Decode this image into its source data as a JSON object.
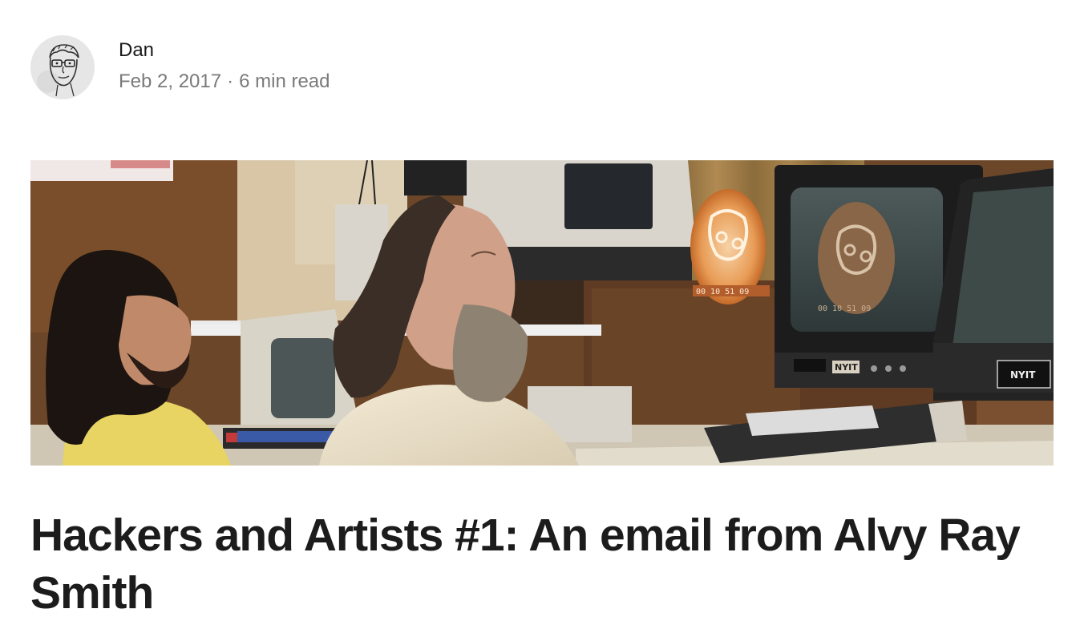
{
  "author": {
    "name": "Dan",
    "avatar_icon": "avatar-sketch-face"
  },
  "meta": {
    "date": "Feb 2, 2017",
    "separator": "·",
    "read_time": "6 min read"
  },
  "hero": {
    "image_label": "photo-two-men-at-computer-terminals",
    "monitor_badge_1": "NYIT",
    "monitor_badge_2": "NYIT",
    "timecode_1": "00 10 51 09",
    "timecode_2": "00 10 51 09"
  },
  "article": {
    "title": "Hackers and Artists #1: An email from Alvy Ray Smith"
  },
  "colors": {
    "text_primary": "#1a1a1a",
    "text_meta": "#7a7a7a",
    "background": "#ffffff"
  }
}
